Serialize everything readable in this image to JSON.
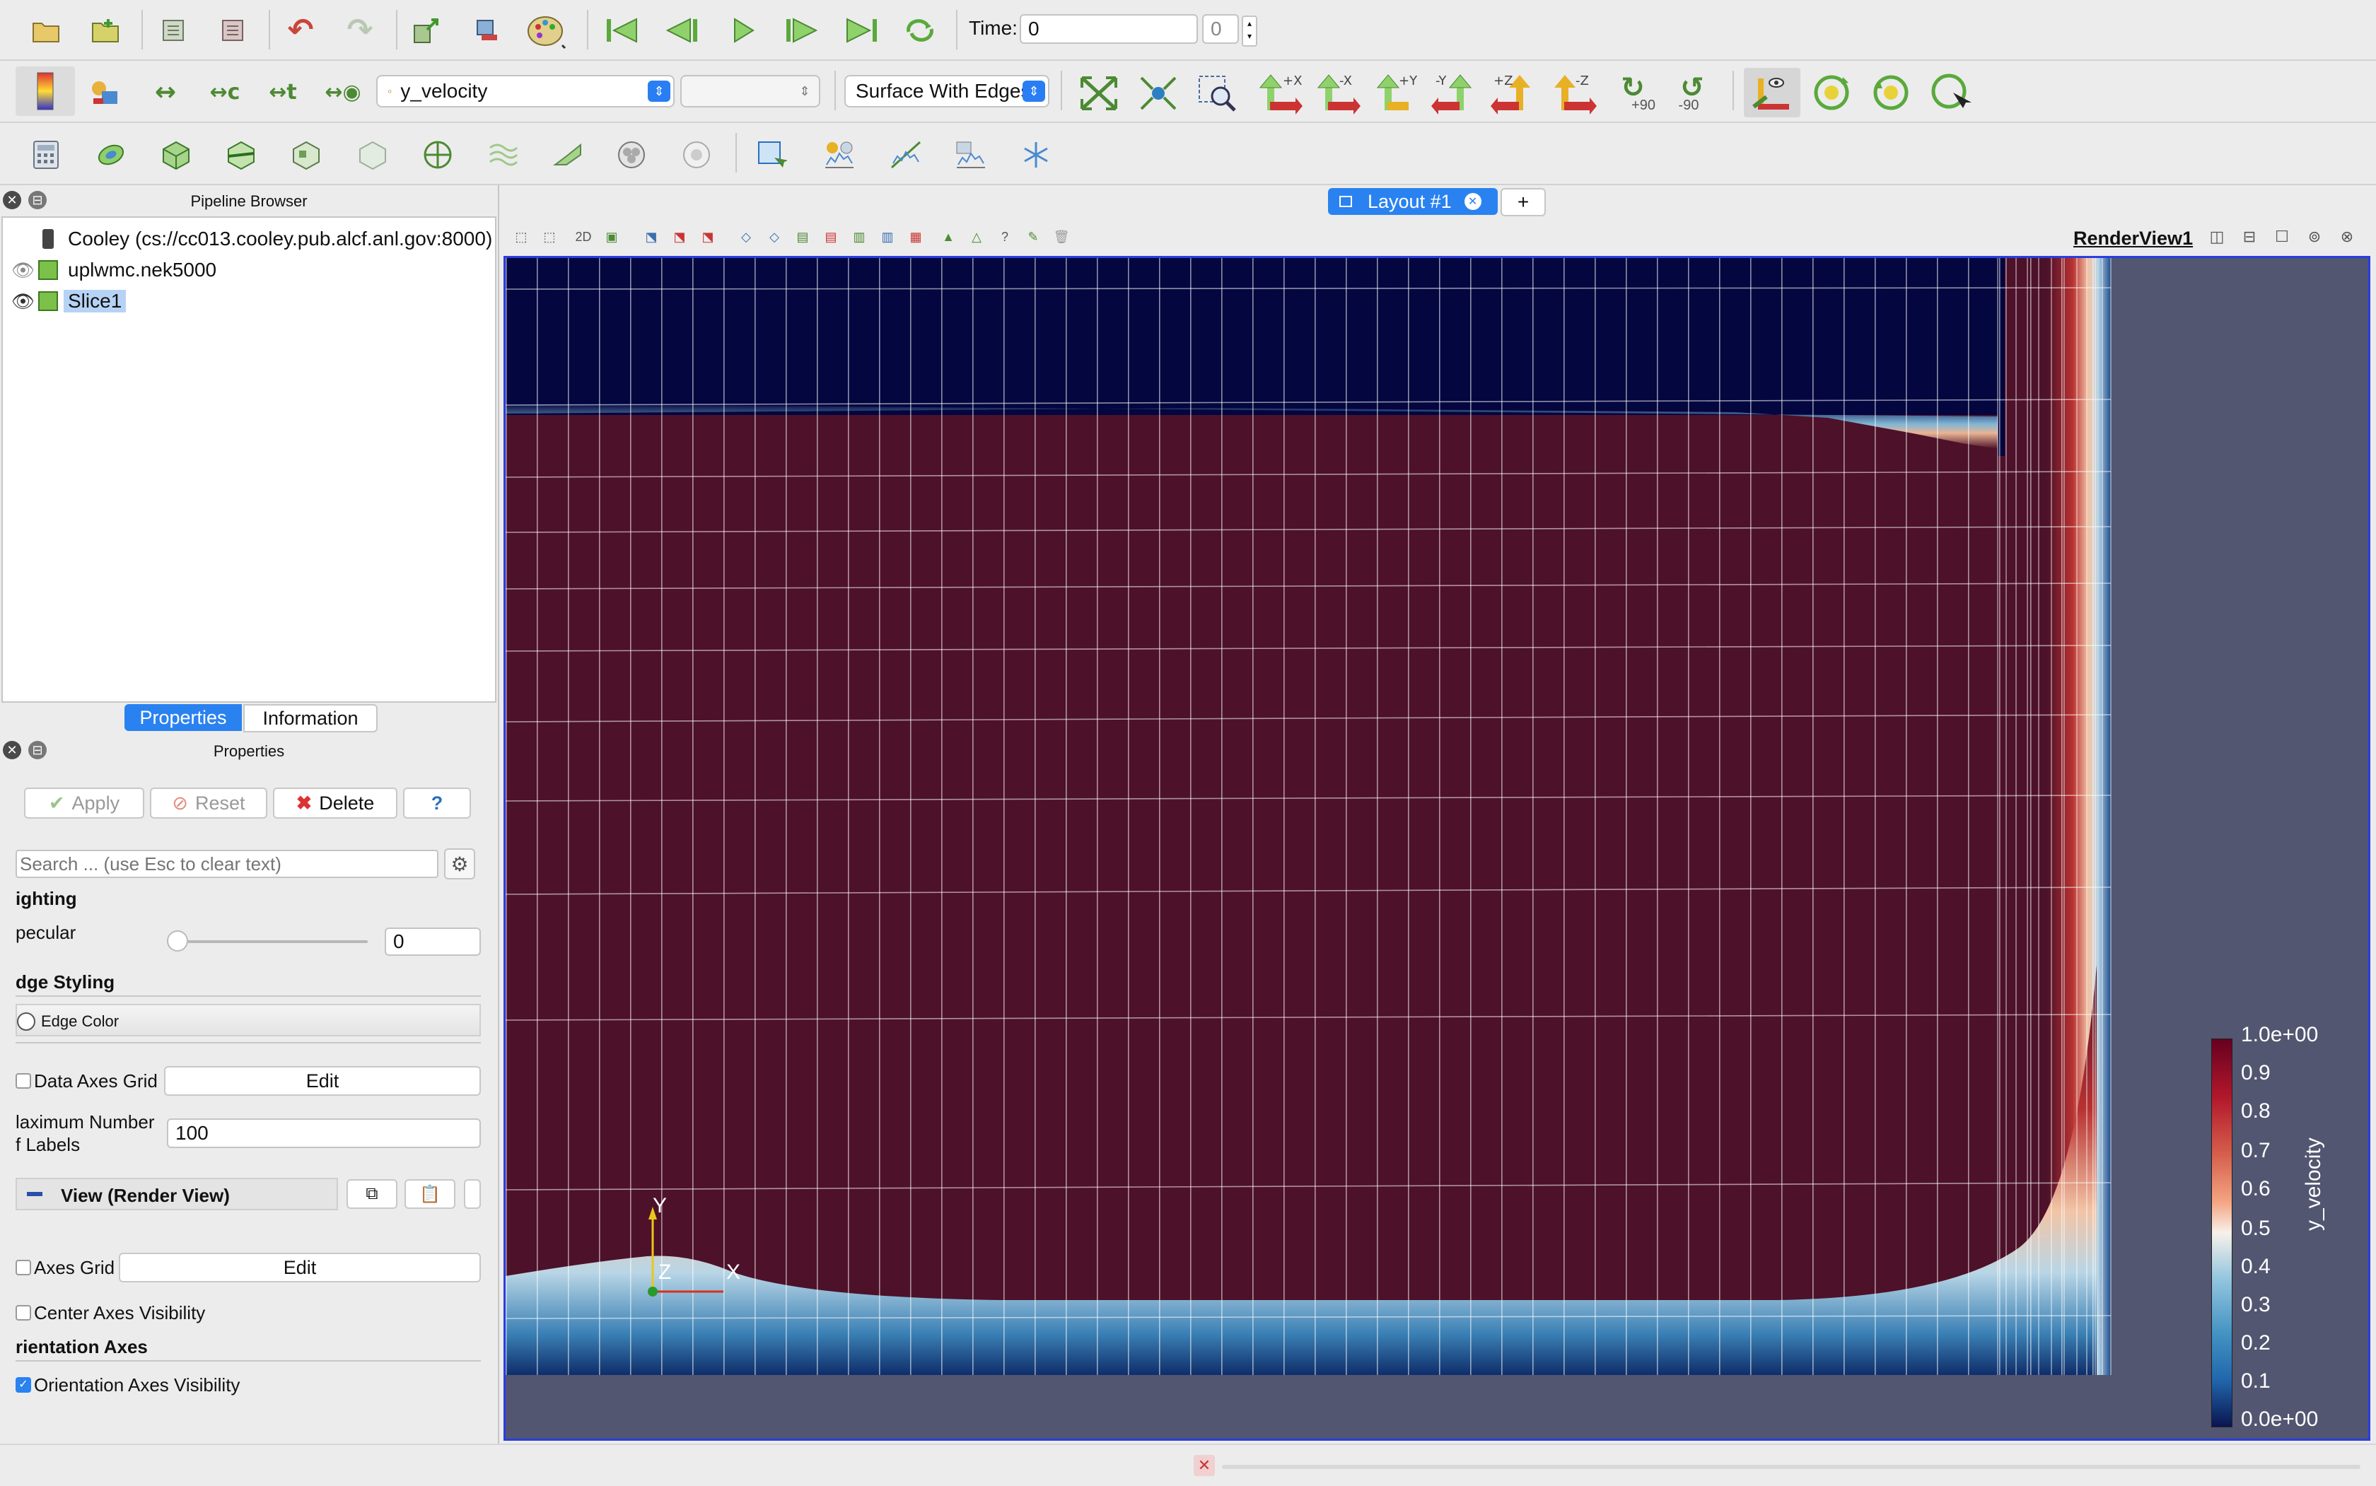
{
  "toolbar": {
    "time_label": "Time:",
    "time_value": "0",
    "time_step": "0",
    "variable_select": "y_velocity",
    "component_select": "",
    "representation_select": "Surface With Edges",
    "rotate_plus90": "+90",
    "rotate_minus90": "-90",
    "axis_buttons": [
      "+X",
      "-X",
      "+Y",
      "-Y",
      "+Z",
      "-Z"
    ]
  },
  "pipeline": {
    "title": "Pipeline Browser",
    "items": [
      {
        "label": "Cooley (cs://cc013.cooley.pub.alcf.anl.gov:8000)"
      },
      {
        "label": "uplwmc.nek5000"
      },
      {
        "label": "Slice1"
      }
    ]
  },
  "tabs": {
    "properties": "Properties",
    "information": "Information"
  },
  "properties": {
    "title": "Properties",
    "apply": "Apply",
    "reset": "Reset",
    "delete": "Delete",
    "help": "?",
    "search_placeholder": "Search ... (use Esc to clear text)",
    "lighting_heading": "ighting",
    "specular_label": "pecular",
    "specular_value": "0",
    "edge_styling_heading": "dge Styling",
    "edge_color_label": "Edge Color",
    "data_axes_grid_label": "Data Axes Grid",
    "edit": "Edit",
    "max_labels_line1": "laximum Number",
    "max_labels_line2": "f Labels",
    "max_labels_value": "100",
    "view_section": "View (Render View)",
    "axes_grid_label": "Axes Grid",
    "center_axes_label": "Center Axes Visibility",
    "orientation_heading": "rientation Axes",
    "orientation_visibility_label": "Orientation Axes Visibility"
  },
  "layout": {
    "tab_label": "Layout #1",
    "add_tab": "+",
    "render_view_title": "RenderView1",
    "view_toolbar_2d": "2D"
  },
  "render": {
    "axis_y": "Y",
    "axis_z": "Z",
    "axis_x": "X",
    "colorbar_title": "y_velocity",
    "colorbar_ticks": [
      "1.0e+00",
      "0.9",
      "0.8",
      "0.7",
      "0.6",
      "0.5",
      "0.4",
      "0.3",
      "0.2",
      "0.1",
      "0.0e+00"
    ],
    "colorbar_colors": {
      "top": "#67001f",
      "upper": "#c23a3a",
      "mid": "#f7f1ea",
      "lower": "#3a86b8",
      "bottom": "#0a1550"
    },
    "background": "#525670",
    "field_main_color": "#4d1129",
    "field_top_color": "#03063f"
  },
  "statusbar": {
    "close_symbol": "✕"
  }
}
